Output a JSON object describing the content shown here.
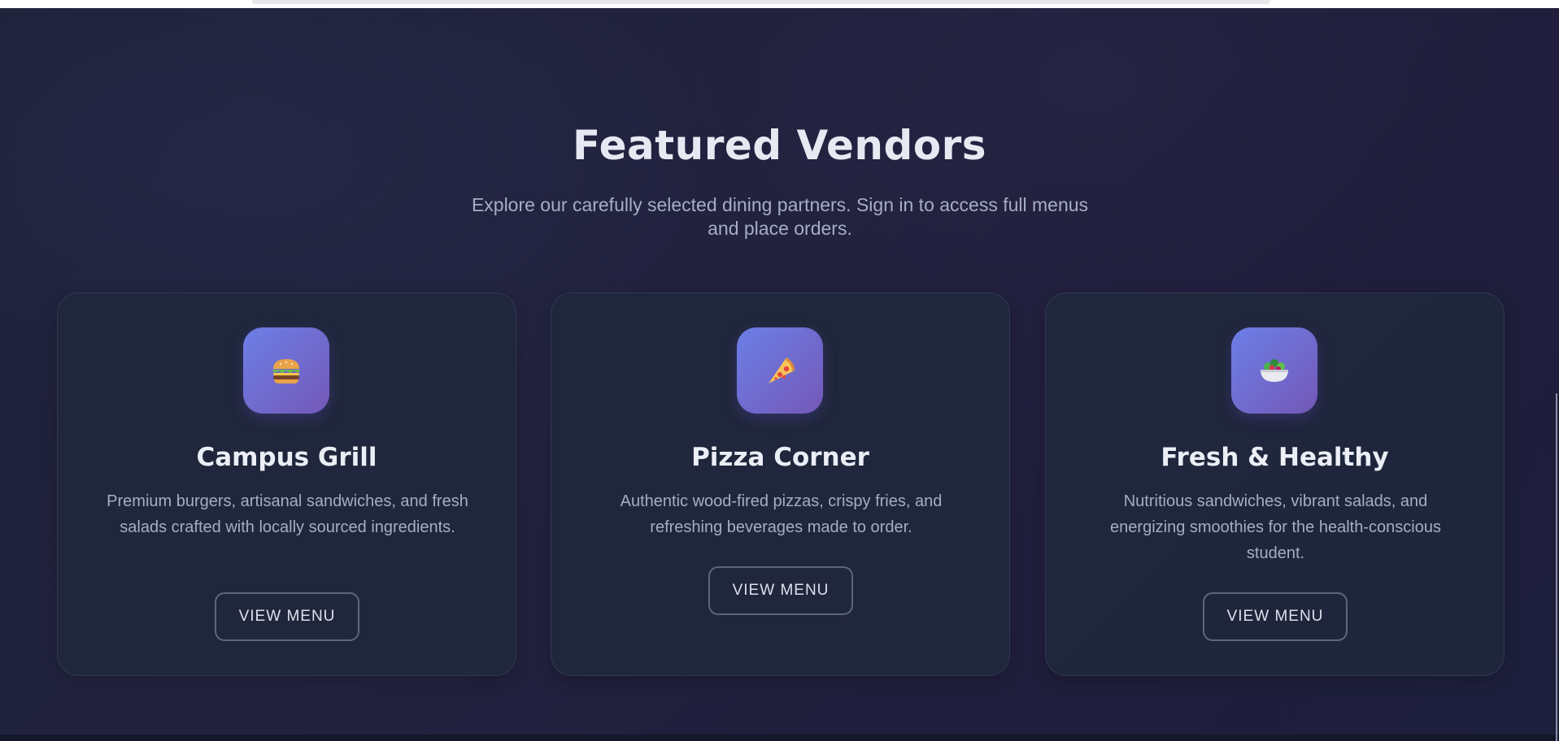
{
  "section": {
    "title": "Featured Vendors",
    "subtitle": "Explore our carefully selected dining partners. Sign in to access full menus and place orders."
  },
  "vendors": [
    {
      "name": "Campus Grill",
      "icon": "burger-icon",
      "description": "Premium burgers, artisanal sandwiches, and fresh salads crafted with locally sourced ingredients.",
      "button_label": "VIEW MENU"
    },
    {
      "name": "Pizza Corner",
      "icon": "pizza-icon",
      "description": "Authentic wood-fired pizzas, crispy fries, and refreshing beverages made to order.",
      "button_label": "VIEW MENU"
    },
    {
      "name": "Fresh & Healthy",
      "icon": "salad-icon",
      "description": "Nutritious sandwiches, vibrant salads, and energizing smoothies for the health-conscious student.",
      "button_label": "VIEW MENU"
    }
  ],
  "colors": {
    "background": "#1e2138",
    "card": "#202838",
    "icon_gradient_start": "#6c7fe6",
    "icon_gradient_end": "#7458b8",
    "heading_text": "#e7e9f2",
    "body_text": "#a5adc1",
    "button_border": "#5d6680"
  }
}
